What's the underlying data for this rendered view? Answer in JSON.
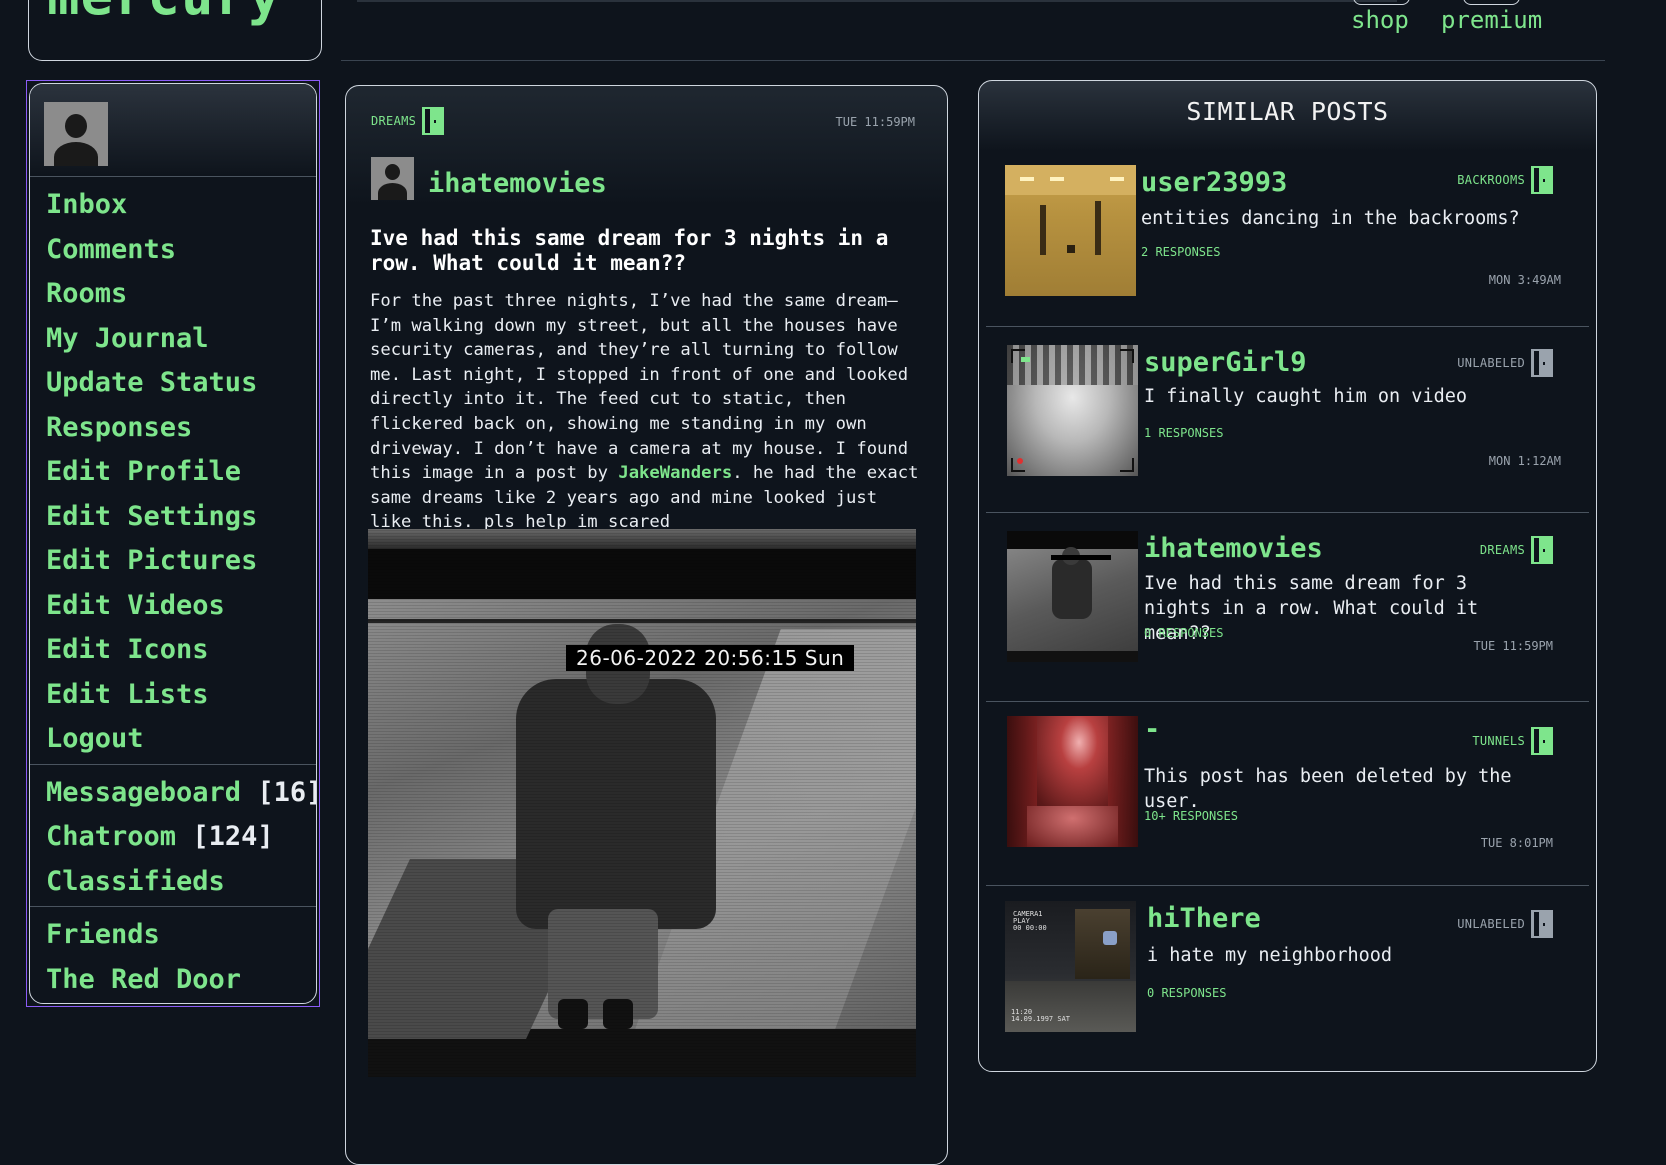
{
  "header": {
    "logo": "mercury",
    "links": [
      "shop",
      "premium"
    ]
  },
  "sidebar": {
    "groups": [
      [
        "Inbox",
        "Comments",
        "Rooms",
        "My Journal",
        "Update Status",
        "Responses",
        "Edit Profile",
        "Edit Settings",
        "Edit Pictures",
        "Edit Videos",
        "Edit Icons",
        "Edit Lists",
        "Logout"
      ],
      [
        {
          "label": "Messageboard",
          "count": "[16]"
        },
        {
          "label": "Chatroom",
          "count": "[124]"
        },
        {
          "label": "Classifieds",
          "count": ""
        }
      ],
      [
        "Friends",
        "The Red Door"
      ]
    ]
  },
  "post": {
    "tag": "DREAMS",
    "time": "TUE 11:59PM",
    "author": "ihatemovies",
    "title": "Ive had this same dream for 3 nights in a row. What could it mean??",
    "body_before": "For the past three nights, I’ve had the same dream—I’m walking down my street, but all the houses have security cameras, and they’re all turning to follow me. Last night, I stopped in front of one and looked directly into it. The feed cut to static, then flickered back on, showing me standing in my own driveway. I don’t have a camera at my house. I found this image in a post by ",
    "mention": "JakeWanders",
    "body_after": ". he had the exact same dreams like 2 years ago and mine looked just like this. pls help im scared",
    "image_timestamp": "26-06-2022 20:56:15 Sun"
  },
  "similar": {
    "title": "SIMILAR POSTS",
    "posts": [
      {
        "user": "user23993",
        "tag": "BACKROOMS",
        "text": "entities dancing in the backrooms?",
        "responses": "2 RESPONSES",
        "time": "MON 3:49AM",
        "tag_color": "green"
      },
      {
        "user": "superGirl9",
        "tag": "UNLABELED",
        "text": "I finally caught him on video",
        "responses": "1 RESPONSES",
        "time": "MON 1:12AM",
        "tag_color": "gray"
      },
      {
        "user": "ihatemovies",
        "tag": "DREAMS",
        "text": "Ive had this same dream for 3 nights in a row. What could it mean??",
        "responses": "0 RESPONSES",
        "time": "TUE 11:59PM",
        "tag_color": "green"
      },
      {
        "user": "-",
        "tag": "TUNNELS",
        "text": "This post has been deleted by the user.",
        "responses": "10+ RESPONSES",
        "time": "TUE 8:01PM",
        "tag_color": "green"
      },
      {
        "user": "hiThere",
        "tag": "UNLABELED",
        "text": "i hate my neighborhood",
        "responses": "0 RESPONSES",
        "time": "",
        "tag_color": "gray"
      }
    ],
    "thumb_texts": {
      "cam5": "CAMERA1\nPLAY\n00 00:00",
      "cam5_date": "11:20\n14.09.1997 SAT",
      "cam2_rec": "REC",
      "cam2_hd": "4K HD"
    }
  }
}
